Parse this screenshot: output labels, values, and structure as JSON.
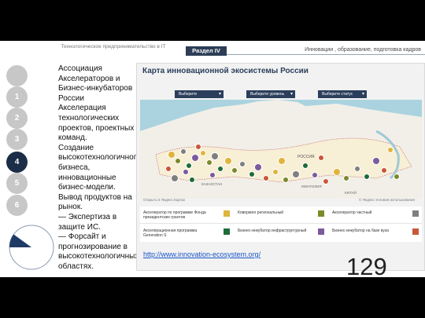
{
  "header": {
    "left_text": "Технологическое предпринимательство в IT",
    "section_badge": "Раздел IV",
    "right_text": "Инновации , образование, подготовка кадров"
  },
  "nav": {
    "items": [
      "",
      "1",
      "2",
      "3",
      "4",
      "5",
      "6"
    ],
    "active_label": "4"
  },
  "body": {
    "paragraphs": [
      "Ассоциация Акселераторов и Бизнес-инкубаторов России",
      "Акселерация технологических проектов, проектных команд.",
      "Создание высокотехнологичного бизнеса, инновационные бизнес-модели.",
      "Вывод продуктов на рынок.",
      "— Экспертиза в защите ИС.",
      "— Форсайт и прогнозирование в высокотехнологичных областях."
    ]
  },
  "progress": {
    "fraction": 0.1
  },
  "map_panel": {
    "title": "Карта инновационной экосистемы России",
    "filters": [
      "Выберите специализацию",
      "Выберите уровень",
      "Выберите статус"
    ],
    "map_labels": {
      "russia": "РОССИЯ",
      "kazakhstan": "КАЗАХСТАН",
      "mongolia": "МОНГОЛИЯ",
      "china": "КИТАЙ"
    },
    "footer_left": "Открыть в Яндекс.Картах",
    "footer_right": "© Яндекс  Условия использования",
    "legend": [
      {
        "label": "Акселератор по программе Фонда президентских грантов",
        "color": "#e0b43c"
      },
      {
        "label": "Коворкинг региональный",
        "color": "#7b8a2a"
      },
      {
        "label": "Акселератор частный",
        "color": "#7f7f7f"
      },
      {
        "label": "Акселерационная программа Generation S",
        "color": "#1e6b3a"
      },
      {
        "label": "Бизнес-инкубатор инфраструктурный",
        "color": "#7b5a9e"
      },
      {
        "label": "Бизнес-инкубатор на базе вуза",
        "color": "#c9573a"
      }
    ]
  },
  "link": {
    "text": "http://www.innovation-ecosystem.org/"
  },
  "page_number": "129"
}
